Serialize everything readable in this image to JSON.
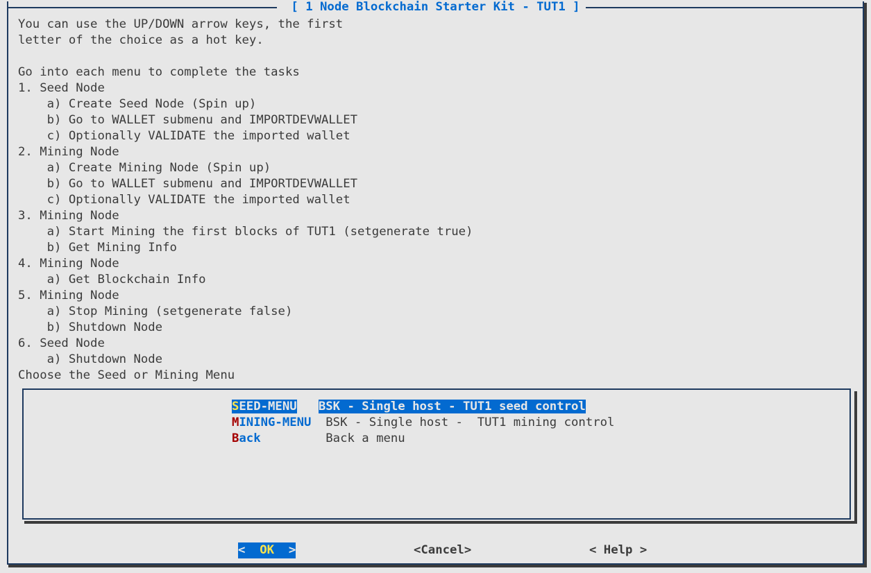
{
  "title": "[ 1 Node Blockchain Starter Kit - TUT1 ]",
  "instructions": "You can use the UP/DOWN arrow keys, the first\nletter of the choice as a hot key.\n\nGo into each menu to complete the tasks\n1. Seed Node\n    a) Create Seed Node (Spin up)\n    b) Go to WALLET submenu and IMPORTDEVWALLET\n    c) Optionally VALIDATE the imported wallet\n2. Mining Node\n    a) Create Mining Node (Spin up)\n    b) Go to WALLET submenu and IMPORTDEVWALLET\n    c) Optionally VALIDATE the imported wallet\n3. Mining Node\n    a) Start Mining the first blocks of TUT1 (setgenerate true)\n    b) Get Mining Info\n4. Mining Node\n    a) Get Blockchain Info\n5. Mining Node\n    a) Stop Mining (setgenerate false)\n    b) Shutdown Node\n6. Seed Node\n    a) Shutdown Node\nChoose the Seed or Mining Menu",
  "menu": {
    "items": [
      {
        "hot": "S",
        "rest": "EED-MENU",
        "pad": "   ",
        "desc": "BSK - Single host - TUT1 seed control",
        "selected": true
      },
      {
        "hot": "M",
        "rest": "INING-MENU",
        "pad": " ",
        "desc": " BSK - Single host -  TUT1 mining control",
        "selected": false
      },
      {
        "hot": "B",
        "rest": "ack",
        "pad": "        ",
        "desc": " Back a menu",
        "selected": false
      }
    ]
  },
  "buttons": {
    "ok": {
      "lt": "<  ",
      "label": "OK",
      "gt": "  >"
    },
    "cancel": "<Cancel>",
    "help": "< Help >"
  }
}
